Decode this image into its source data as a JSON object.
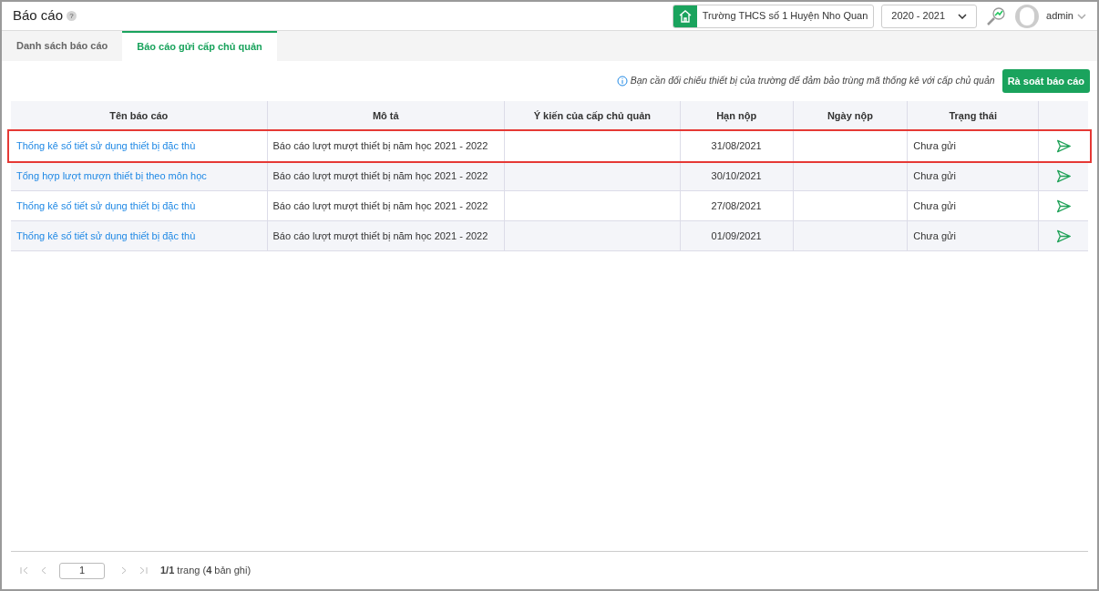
{
  "header": {
    "title": "Báo cáo",
    "help": "?",
    "school": "Trường THCS số 1 Huyện Nho Quan",
    "year": "2020 - 2021",
    "user": "admin"
  },
  "tabs": [
    {
      "label": "Danh sách báo cáo",
      "selected": false
    },
    {
      "label": "Báo cáo gửi cấp chủ quản",
      "selected": true
    }
  ],
  "notice": "Bạn cần đối chiếu thiết bị của trường để đảm bảo trùng mã thống kê với cấp chủ quản",
  "review_button": "Rà soát báo cáo",
  "table": {
    "columns": [
      "Tên báo cáo",
      "Mô tả",
      "Ý kiến của cấp chủ quản",
      "Hạn nộp",
      "Ngày nộp",
      "Trạng thái"
    ],
    "rows": [
      {
        "name": "Thống kê số tiết sử dụng thiết bị đặc thù",
        "description": "Báo cáo lượt mượt thiết bị năm học 2021 - 2022",
        "deadline": "31/08/2021",
        "status": "Chưa gửi",
        "selected": true
      },
      {
        "name": "Tổng hợp lượt mượn thiết bị theo môn học",
        "description": "Báo cáo lượt mượt thiết bị năm học 2021 - 2022",
        "deadline": "30/10/2021",
        "status": "Chưa gửi",
        "selected": false
      },
      {
        "name": "Thống kê số tiết sử dụng thiết bị đặc thù",
        "description": "Báo cáo lượt mượt thiết bị năm học 2021 - 2022",
        "deadline": "27/08/2021",
        "status": "Chưa gửi",
        "selected": false
      },
      {
        "name": "Thống kê số tiết sử dụng thiết bị đặc thù",
        "description": "Báo cáo lượt mượt thiết bị năm học 2021 - 2022",
        "deadline": "01/09/2021",
        "status": "Chưa gửi",
        "selected": false
      }
    ]
  },
  "pagination": {
    "page": "1",
    "summary": "**1/1** trang (**4** bản ghi)"
  }
}
